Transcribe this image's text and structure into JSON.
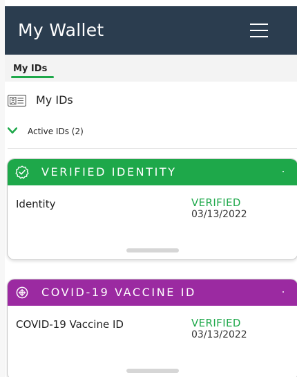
{
  "header": {
    "title": "My Wallet",
    "menu_icon": "hamburger-menu-icon"
  },
  "tabs": [
    {
      "label": "My IDs",
      "active": true
    }
  ],
  "section": {
    "title": "My IDs",
    "icon": "id-card-icon"
  },
  "active_group": {
    "label": "Active IDs (2)",
    "expanded": true,
    "icon": "chevron-down-icon"
  },
  "cards": [
    {
      "band_title": "VERIFIED IDENTITY",
      "band_icon": "verified-badge-icon",
      "band_color": "#1ea84a",
      "name": "Identity",
      "status": "VERIFIED",
      "date": "03/13/2022"
    },
    {
      "band_title": "COVID-19 VACCINE ID",
      "band_icon": "vaccine-shield-icon",
      "band_color": "#9b2aa1",
      "name": "COVID-19 Vaccine ID",
      "status": "VERIFIED",
      "date": "03/13/2022"
    }
  ],
  "colors": {
    "header_bg": "#2b3d4f",
    "accent_green": "#1ea84a",
    "tab_bar_bg": "#f3f3f3"
  }
}
